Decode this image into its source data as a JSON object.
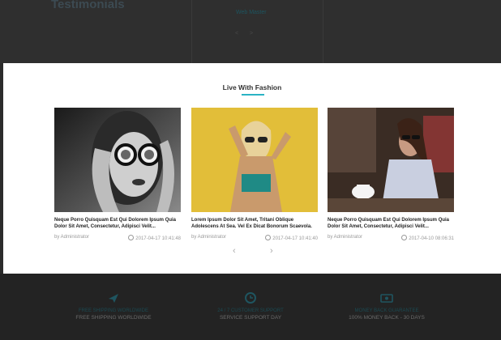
{
  "background": {
    "section_title": "Testimonials",
    "tagline": "Web Master",
    "carousel_dots": "< >",
    "features": [
      {
        "icon": "plane-icon",
        "title": "FREE SHIPPING WORLDWIDE",
        "subtitle": "FREE SHIPPING WORLDWIDE"
      },
      {
        "icon": "support-icon",
        "title": "24 / 7 CUSTOMER SUPPORT",
        "subtitle": "SERVICE SUPPORT DAY"
      },
      {
        "icon": "money-icon",
        "title": "MONEY BACK GUARANTEE",
        "subtitle": "100% MONEY BACK - 30 DAYS"
      }
    ]
  },
  "modal": {
    "title": "Live With Fashion",
    "accent_color": "#2bb3c4",
    "prev_label": "‹",
    "next_label": "›",
    "posts": [
      {
        "headline": "Neque Porro Quisquam Est Qui Dolorem Ipsum Quia Dolor Sit Amet, Consectetur, Adipisci Velit...",
        "author": "by Administrator",
        "date": "2017-04-17 10:41:48"
      },
      {
        "headline": "Lorem Ipsum Dolor Sit Amet, Tritani Oblique Adolescens At Sea. Vel Ex Dicat Bonorum Scaevola.",
        "author": "by Administrator",
        "date": "2017-04-17 10:41:40"
      },
      {
        "headline": "Neque Porro Quisquam Est Qui Dolorem Ipsum Quia Dolor Sit Amet, Consectetur, Adipisci Velit...",
        "author": "by Administrator",
        "date": "2017-04-10 08:06:31"
      }
    ]
  }
}
